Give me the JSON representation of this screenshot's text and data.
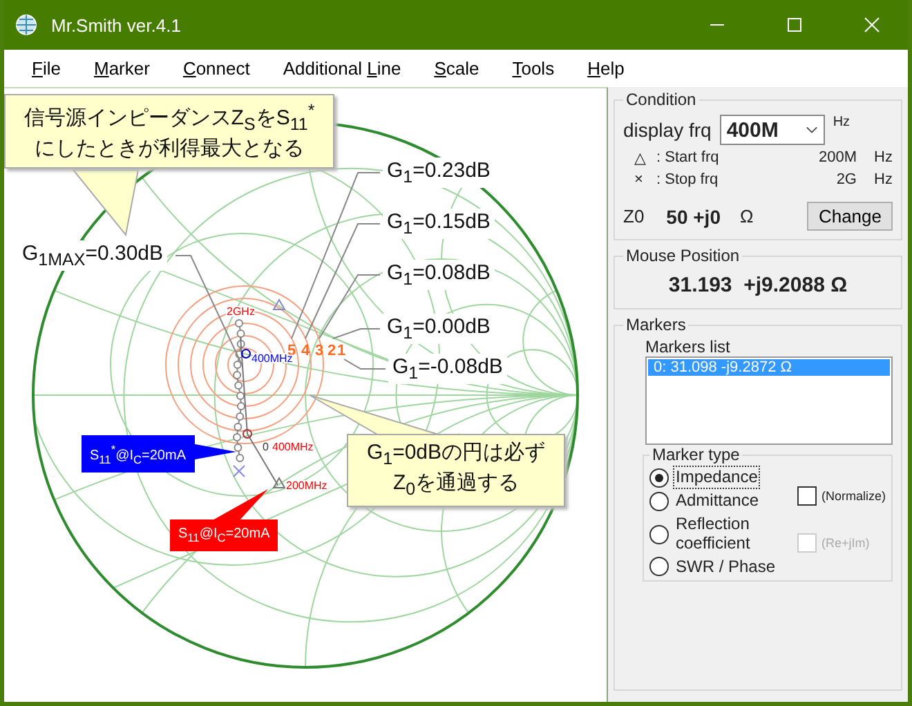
{
  "window": {
    "title": "Mr.Smith ver.4.1"
  },
  "menu": [
    {
      "key": "F",
      "post": "ile"
    },
    {
      "key": "M",
      "post": "arker"
    },
    {
      "key": "C",
      "post": "onnect"
    },
    {
      "pre": "Additional ",
      "key": "L",
      "post": "ine"
    },
    {
      "key": "S",
      "post": "cale"
    },
    {
      "key": "T",
      "post": "ools"
    },
    {
      "key": "H",
      "post": "elp"
    }
  ],
  "chart": {
    "callouts": [
      {
        "lines": [
          "信号源インピーダンスZ$_{S}$をS$_{11}$$^{*}$",
          "にしたときが利得最大となる"
        ]
      },
      {
        "lines": [
          "G$_{1}$=0dBの円は必ず",
          "Z$_{0}$を通過する"
        ]
      }
    ],
    "gain_labels": [
      "G$_{1MAX}$=0.30dB",
      "G$_{1}$=0.23dB",
      "G$_{1}$=0.15dB",
      "G$_{1}$=0.08dB",
      "G$_{1}$=0.00dB",
      "G$_{1}$=-0.08dB"
    ],
    "circle_numbers": [
      "5",
      "4",
      "3",
      "2",
      "1"
    ],
    "trace_labels": [
      {
        "text": "2GHz",
        "color": "#ff0000"
      },
      {
        "text": "400MHz",
        "color": "#0000ff"
      },
      {
        "text": "0",
        "color": "#333333"
      },
      {
        "text": "400MHz",
        "color": "#ff0000"
      },
      {
        "text": "200MHz",
        "color": "#ff0000"
      }
    ],
    "tags": [
      {
        "text": "S$_{11}$$^{*}$@I$_{C}$=20mA",
        "color": "#0000ff"
      },
      {
        "text": "S$_{11}$@I$_{C}$=20mA",
        "color": "#ff0000"
      }
    ]
  },
  "condition": {
    "title": "Condition",
    "display_label": "display frq",
    "display_value": "400M",
    "display_unit": "Hz",
    "rows": [
      {
        "symbol": "△",
        "label": ": Start frq",
        "value": "200M",
        "unit": "Hz"
      },
      {
        "symbol": "×",
        "label": ": Stop frq",
        "value": "2G",
        "unit": "Hz"
      }
    ],
    "z0_label": "Z0",
    "z0_value": "50 +j0",
    "z0_unit": "Ω",
    "button": "Change"
  },
  "mouse_position": {
    "title": "Mouse Position",
    "value": "31.193  +j9.2088 Ω"
  },
  "markers": {
    "title": "Markers",
    "list_title": "Markers list",
    "items": [
      {
        "text": "0: 31.098 -j9.2872 Ω",
        "selected": true
      }
    ],
    "marker_type": {
      "title": "Marker type",
      "options": [
        {
          "label": "Impedance",
          "selected": true
        },
        {
          "label": "Admittance",
          "selected": false
        },
        {
          "label": "Reflection coefficient",
          "selected": false
        },
        {
          "label": "SWR / Phase",
          "selected": false
        }
      ],
      "checks": [
        {
          "label": "(Normalize)",
          "checked": false,
          "disabled": false
        },
        {
          "label": "(Re+jIm)",
          "checked": false,
          "disabled": true
        }
      ]
    }
  }
}
